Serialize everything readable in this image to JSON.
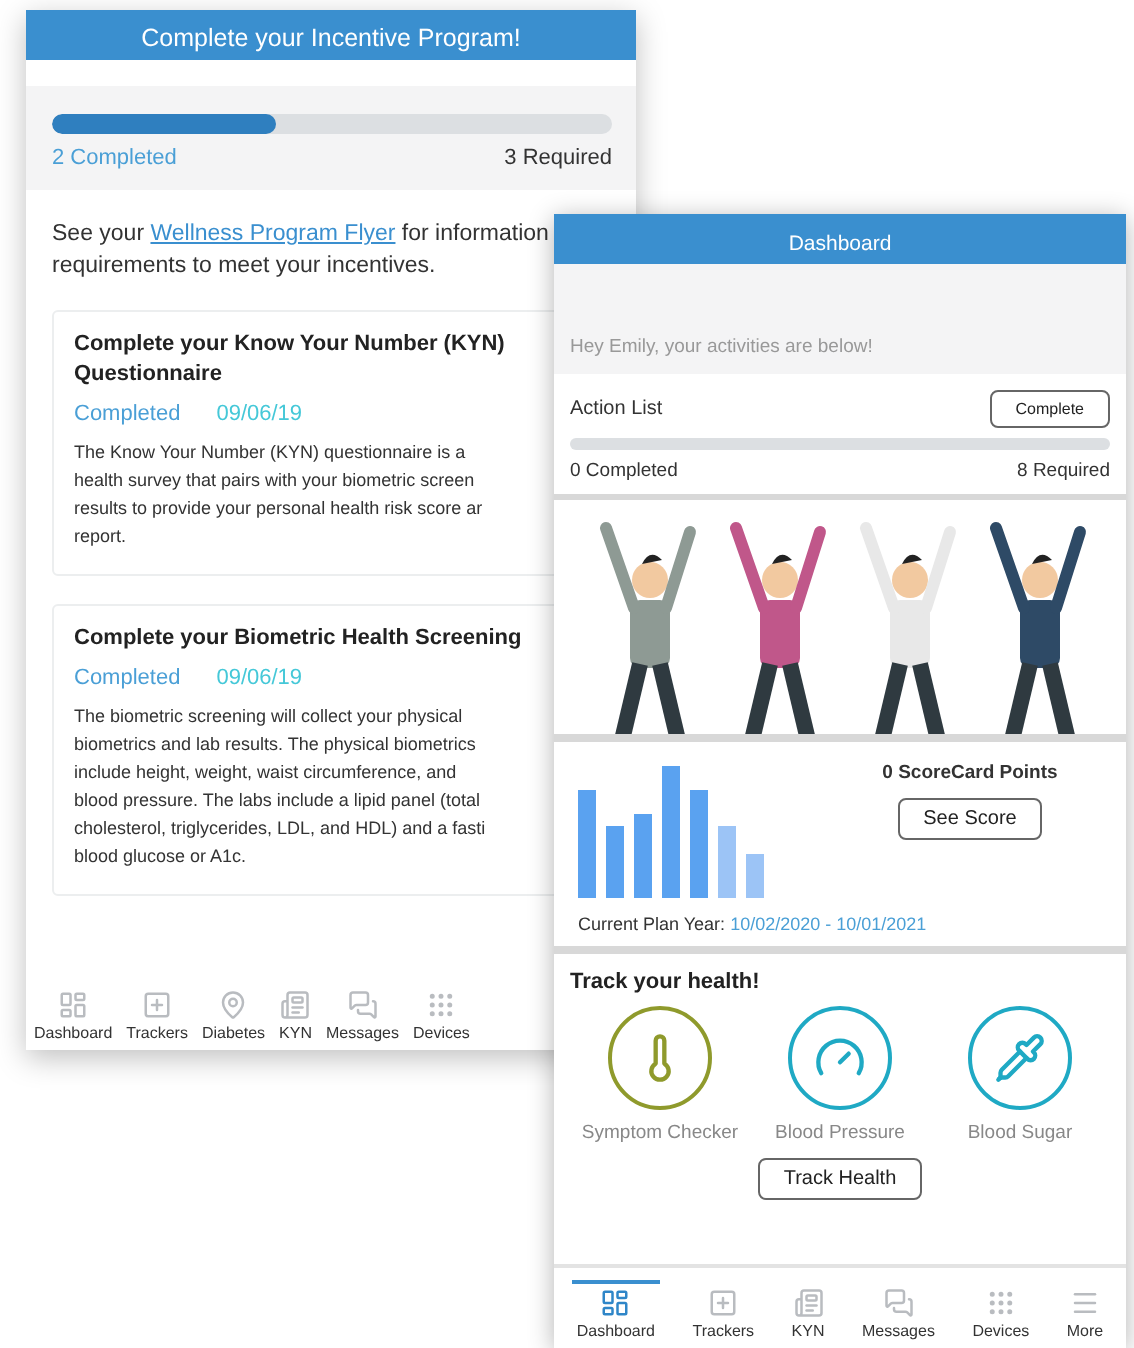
{
  "incentive_screen": {
    "title": "Complete your Incentive Program!",
    "progress": {
      "level": 0.4,
      "completed": "2 Completed",
      "required": "3 Required"
    },
    "intro": {
      "before": "See your ",
      "link": "Wellness Program Flyer",
      "after_lines": [
        " for information",
        "requirements to meet your incentives."
      ]
    },
    "cards": [
      {
        "title": "Complete your Know Your Number (KYN) Questionnaire",
        "status": "Completed",
        "date": "09/06/19",
        "lines": [
          "The Know Your Number (KYN) questionnaire is a",
          "health survey that pairs with your biometric screen",
          "results to provide your personal health risk score ar",
          "report."
        ]
      },
      {
        "title": "Complete your Biometric Health Screening",
        "status": "Completed",
        "date": "09/06/19",
        "lines": [
          "The biometric screening will collect your physical",
          "biometrics and lab results. The physical biometrics",
          "include height, weight, waist circumference, and",
          "blood pressure. The labs include a lipid panel (total",
          "cholesterol, triglycerides, LDL, and HDL) and a fasti",
          "blood glucose or A1c."
        ]
      }
    ],
    "nav": [
      {
        "kind": "dashboard",
        "label": "Dashboard",
        "selected": false
      },
      {
        "kind": "trackers",
        "label": "Trackers",
        "selected": false
      },
      {
        "kind": "pin",
        "label": "Diabetes",
        "selected": false
      },
      {
        "kind": "kyn",
        "label": "KYN",
        "selected": false
      },
      {
        "kind": "messages",
        "label": "Messages",
        "selected": false
      },
      {
        "kind": "devices",
        "label": "Devices",
        "selected": false
      }
    ]
  },
  "dashboard_screen": {
    "title": "Dashboard",
    "greeting": "Hey Emily, your activities are below!",
    "action_list": {
      "label": "Action List",
      "button": "Complete",
      "level": 0,
      "completed": "0 Completed",
      "required": "8 Required"
    },
    "score": {
      "points": "0 ScoreCard Points",
      "button": "See Score",
      "plan_label": "Current Plan Year: ",
      "plan_dates": "10/02/2020 - 10/01/2021"
    },
    "track": {
      "heading": "Track your health!",
      "items": [
        {
          "kind": "symptom",
          "label": "Symptom Checker",
          "color": "#8f9a2c"
        },
        {
          "kind": "pressure",
          "label": "Blood Pressure",
          "color": "#1fa9c4"
        },
        {
          "kind": "sugar",
          "label": "Blood Sugar",
          "color": "#1fa9c4"
        }
      ],
      "button": "Track Health"
    },
    "nav": [
      {
        "kind": "dashboard",
        "label": "Dashboard",
        "selected": true
      },
      {
        "kind": "trackers",
        "label": "Trackers",
        "selected": false
      },
      {
        "kind": "kyn",
        "label": "KYN",
        "selected": false
      },
      {
        "kind": "messages",
        "label": "Messages",
        "selected": false
      },
      {
        "kind": "devices",
        "label": "Devices",
        "selected": false
      },
      {
        "kind": "more",
        "label": "More",
        "selected": false
      }
    ]
  }
}
